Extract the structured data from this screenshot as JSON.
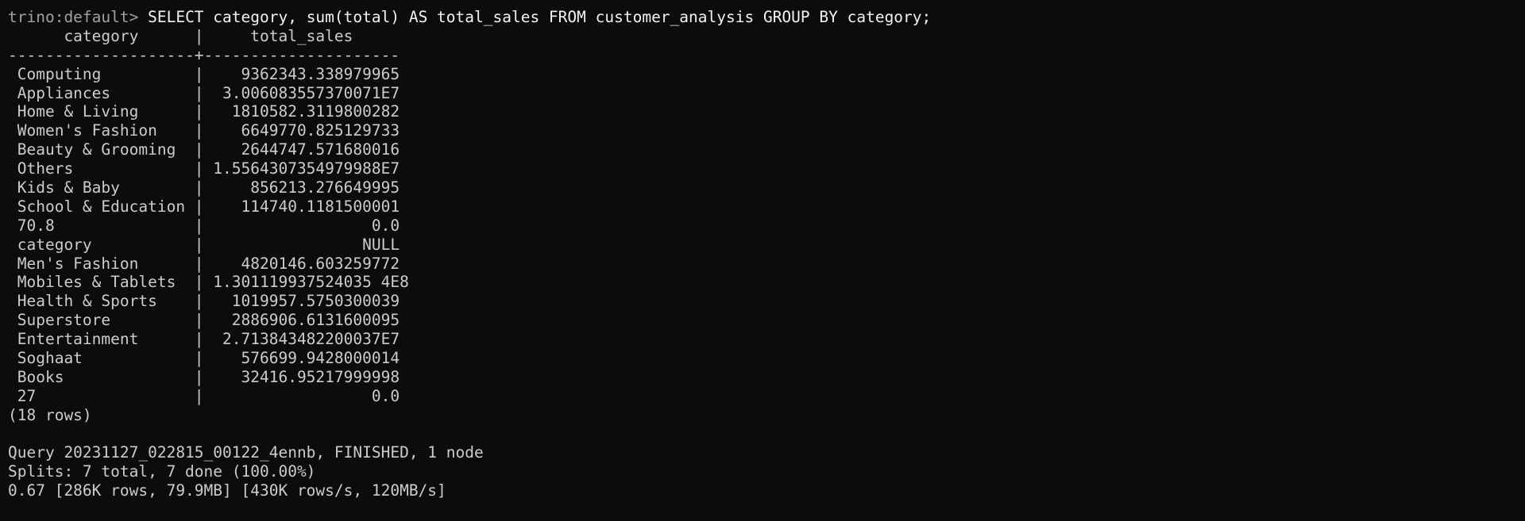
{
  "prompt": {
    "text": "trino:default> ",
    "command": "SELECT category, sum(total) AS total_sales FROM customer_analysis GROUP BY category;"
  },
  "table": {
    "header": "      category      |     total_sales     ",
    "separator": "--------------------+---------------------",
    "rows": [
      " Computing          |    9362343.338979965",
      " Appliances         |  3.006083557370071E7",
      " Home & Living      |   1810582.3119800282",
      " Women's Fashion    |    6649770.825129733",
      " Beauty & Grooming  |    2644747.571680016",
      " Others             | 1.5564307354979988E7",
      " Kids & Baby        |     856213.276649995",
      " School & Education |    114740.1181500001",
      " 70.8               |                  0.0",
      " category           |                 NULL",
      " Men's Fashion      |    4820146.603259772",
      " Mobiles & Tablets  | 1.301119937524035 4E8",
      " Health & Sports    |   1019957.5750300039",
      " Superstore         |   2886906.6131600095",
      " Entertainment      |  2.713843482200037E7",
      " Soghaat            |    576699.9428000014",
      " Books              |    32416.95217999998",
      " 27                 |                  0.0"
    ],
    "row_count": "(18 rows)"
  },
  "summary": {
    "query": "Query 20231127_022815_00122_4ennb, FINISHED, 1 node",
    "splits": "Splits: 7 total, 7 done (100.00%)",
    "stats": "0.67 [286K rows, 79.9MB] [430K rows/s, 120MB/s]"
  },
  "colors": {
    "background": "#0c0c0c",
    "text": "#cccccc",
    "prompt": "#a0a0a0",
    "command": "#f2f2f2"
  }
}
